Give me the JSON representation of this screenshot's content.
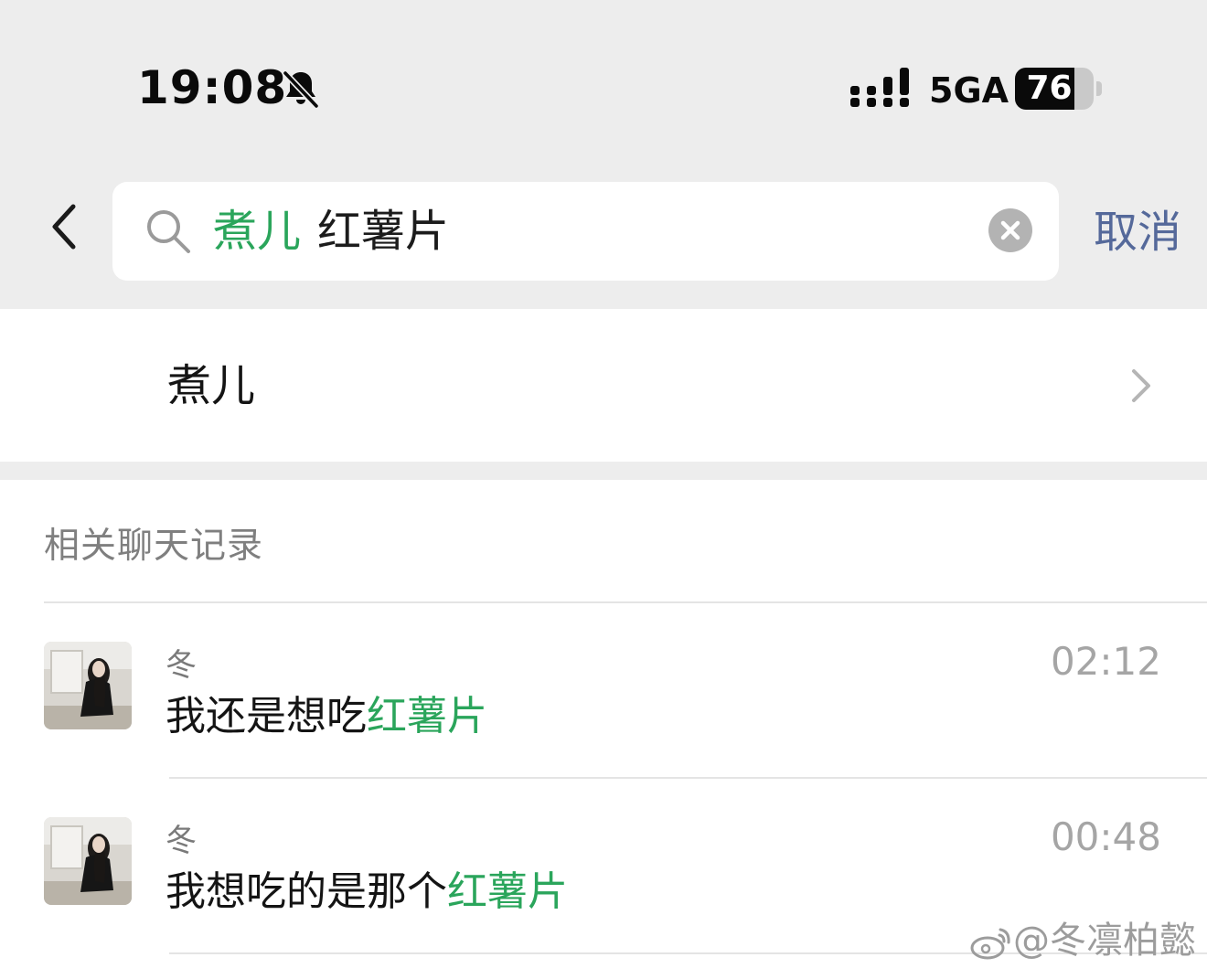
{
  "status_bar": {
    "time": "19:08",
    "network": "5GA",
    "battery_level": "76",
    "battery_fraction": 0.76,
    "icons": [
      "bell-mute-icon",
      "signal-bars-icon",
      "battery-icon"
    ]
  },
  "search": {
    "query_highlight": "煮儿",
    "query_rest": "红薯片",
    "cancel_label": "取消"
  },
  "contact": {
    "name": "煮儿"
  },
  "results": {
    "section_title": "相关聊天记录",
    "items": [
      {
        "sender": "冬",
        "time": "02:12",
        "message_prefix": "我还是想吃",
        "message_highlight": "红薯片"
      },
      {
        "sender": "冬",
        "time": "00:48",
        "message_prefix": "我想吃的是那个",
        "message_highlight": "红薯片"
      }
    ]
  },
  "watermark": {
    "text": "@冬凛柏懿"
  },
  "colors": {
    "highlight": "#2aa55b",
    "cancel": "#55699a",
    "background_gray": "#ededed"
  }
}
